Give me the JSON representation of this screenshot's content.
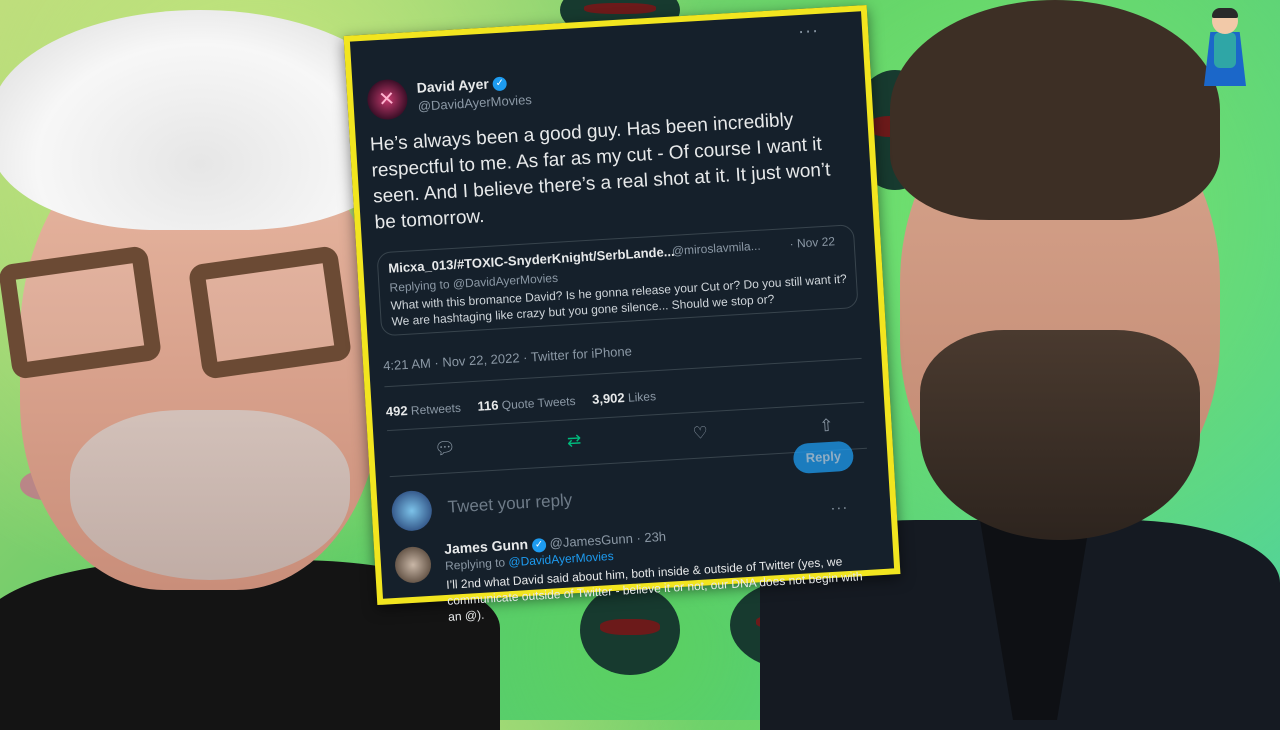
{
  "colors": {
    "frame": "#f2e51f",
    "card_bg": "#15202b",
    "accent": "#1d9bf0",
    "retweet_green": "#00ba7c"
  },
  "tweet": {
    "author_name": "David Ayer",
    "author_handle": "@DavidAyerMovies",
    "text": "He’s always been a good guy. Has been incredibly respectful to me. As far as my cut - Of course I want it seen. And I believe there’s a real shot at it. It just won’t be tomorrow.",
    "quoted": {
      "name": "Micxa_013/#TOXIC-SnyderKnight/SerbLande...",
      "handle": "@miroslavmila...",
      "date": "· Nov 22",
      "replying_to": "Replying to @DavidAyerMovies",
      "text": "What with this bromance David? Is he gonna release your Cut or? Do you still want it? We are hashtaging like crazy but you gone silence... Should we stop or?"
    },
    "meta": "4:21 AM · Nov 22, 2022 · Twitter for iPhone",
    "retweets_count": "492",
    "retweets_label": "Retweets",
    "quote_tweets_count": "116",
    "quote_tweets_label": "Quote Tweets",
    "likes_count": "3,902",
    "likes_label": "Likes"
  },
  "compose": {
    "placeholder": "Tweet your reply",
    "reply_button": "Reply"
  },
  "reply": {
    "name": "James Gunn",
    "handle": "@JamesGunn",
    "time": "· 23h",
    "replying_prefix": "Replying to",
    "replying_handle": "@DavidAyerMovies",
    "text": "I’ll 2nd what David said about him, both inside & outside of Twitter (yes, we communicate outside of Twitter - believe it or not, our DNA does not begin with an @)."
  },
  "icons": [
    "verified-badge-icon",
    "more-icon",
    "reply-icon",
    "retweet-icon",
    "like-icon",
    "share-icon"
  ]
}
